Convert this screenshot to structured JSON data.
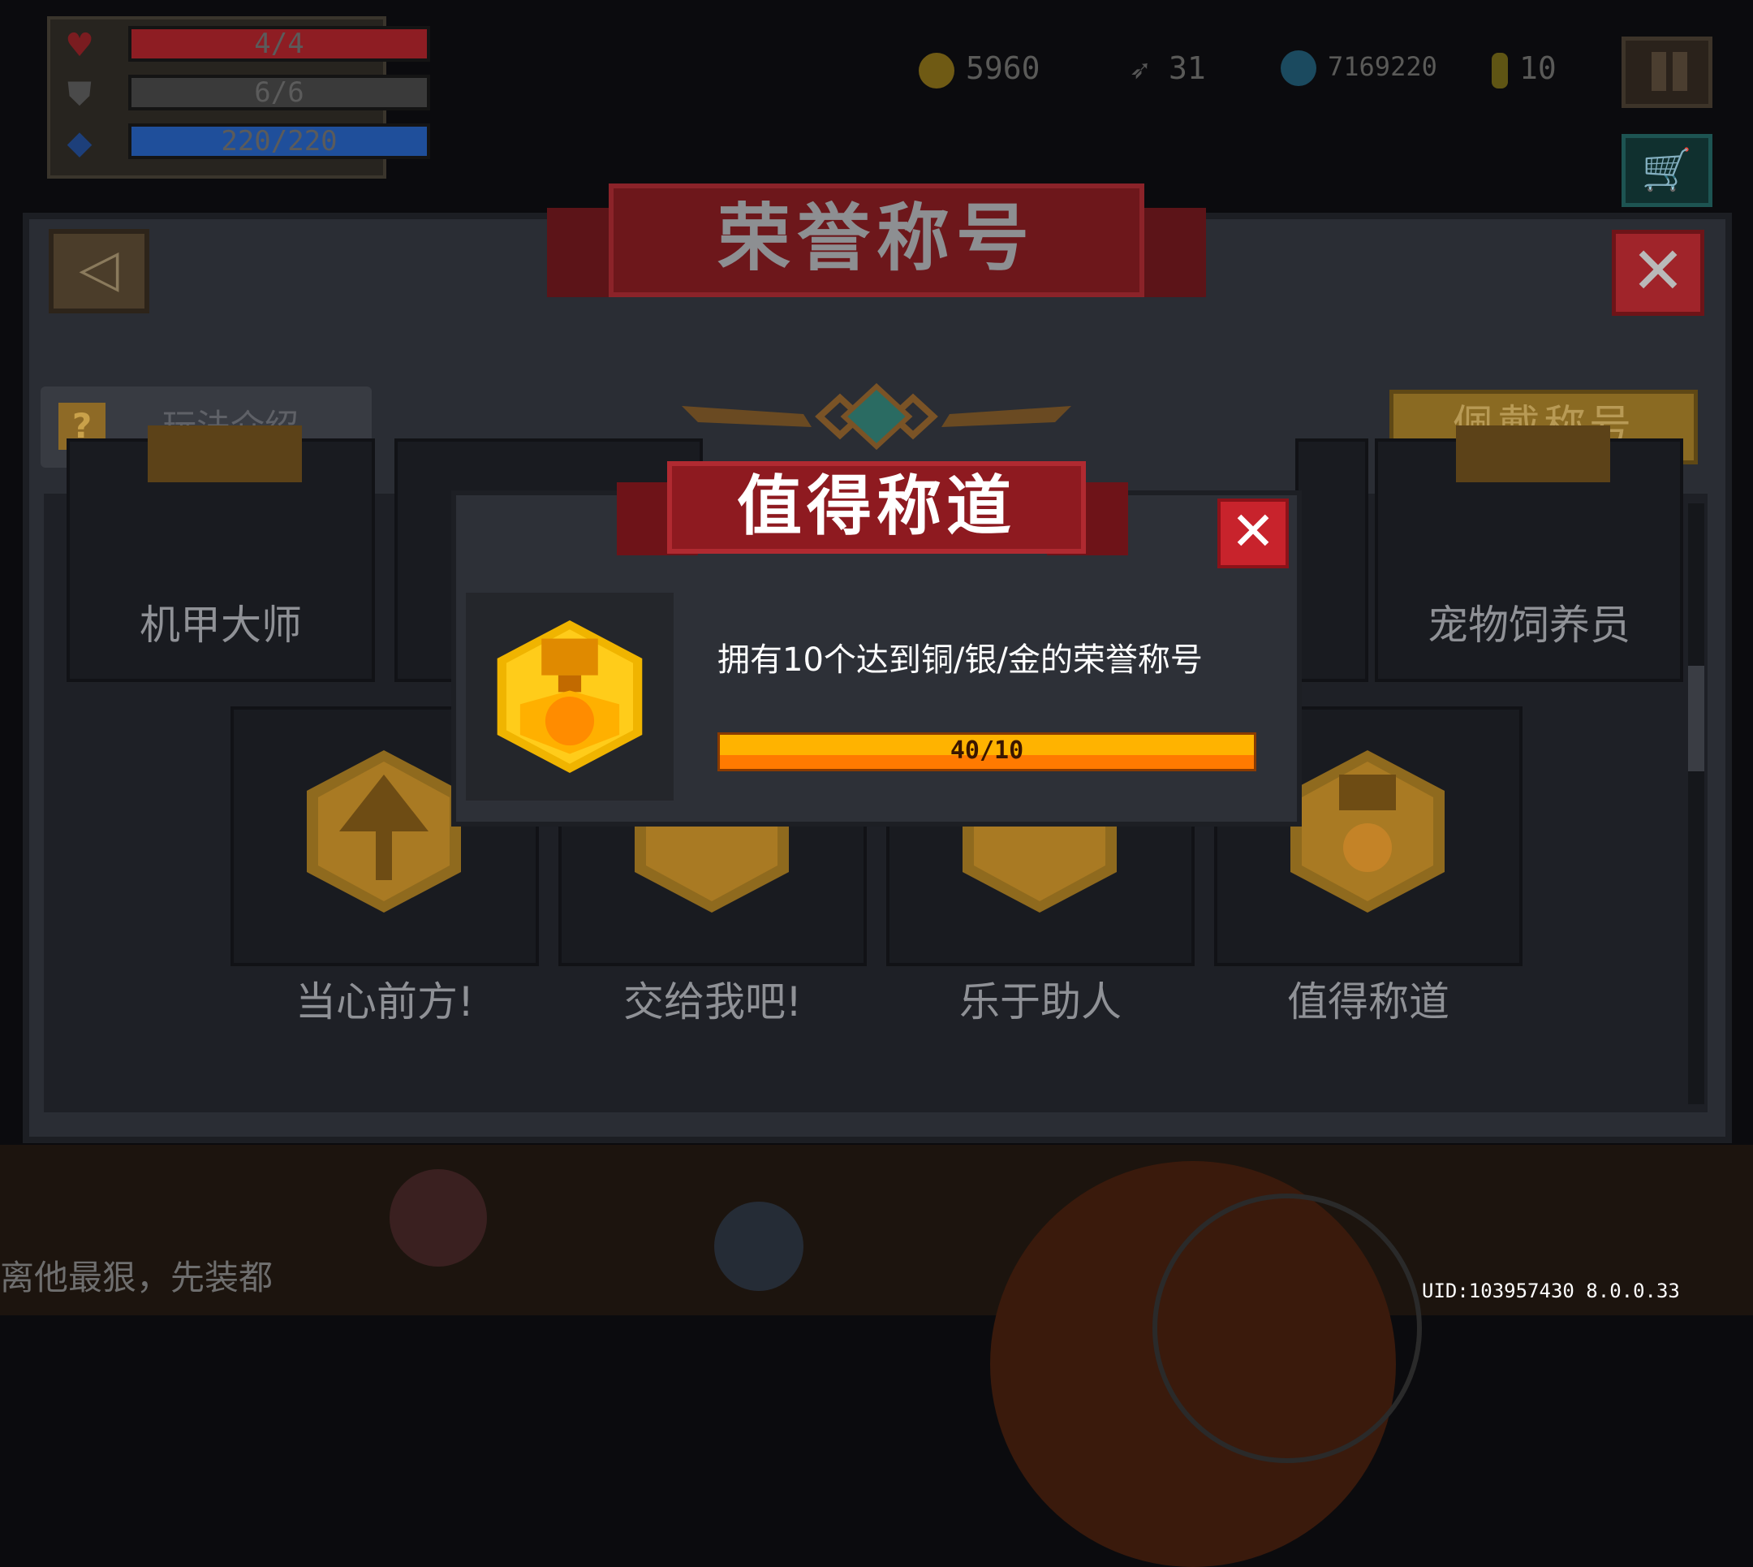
{
  "hud": {
    "hp": {
      "text": "4/4",
      "fraction": 1.0,
      "color": "#8e1d23"
    },
    "armor": {
      "text": "6/6",
      "fraction": 1.0,
      "color": "#3a3a3a"
    },
    "energy": {
      "text": "220/220",
      "fraction": 1.0,
      "color": "#1f4f9b"
    },
    "gold": "5960",
    "feather": "31",
    "gems": "7169220",
    "tokens": "10"
  },
  "panel": {
    "title": "荣誉称号",
    "help_label": "玩法介绍",
    "help_icon": "?",
    "wear_label": "佩戴称号"
  },
  "cards": [
    {
      "label": "机甲大师"
    },
    {
      "label": "宠物饲养员"
    },
    {
      "label": "当心前方!"
    },
    {
      "label": "交给我吧!"
    },
    {
      "label": "乐于助人"
    },
    {
      "label": "值得称道"
    }
  ],
  "modal": {
    "title": "值得称道",
    "description": "拥有10个达到铜/银/金的荣誉称号",
    "progress_text": "40/10",
    "progress_fraction": 1.0
  },
  "background": {
    "partial_text": "离他最狠，先装都"
  },
  "footer": {
    "uid": "UID:103957430 8.0.0.33"
  },
  "colors": {
    "gold": "#ffb300",
    "red_banner": "#8e1a20",
    "close_red": "#c8232c"
  }
}
